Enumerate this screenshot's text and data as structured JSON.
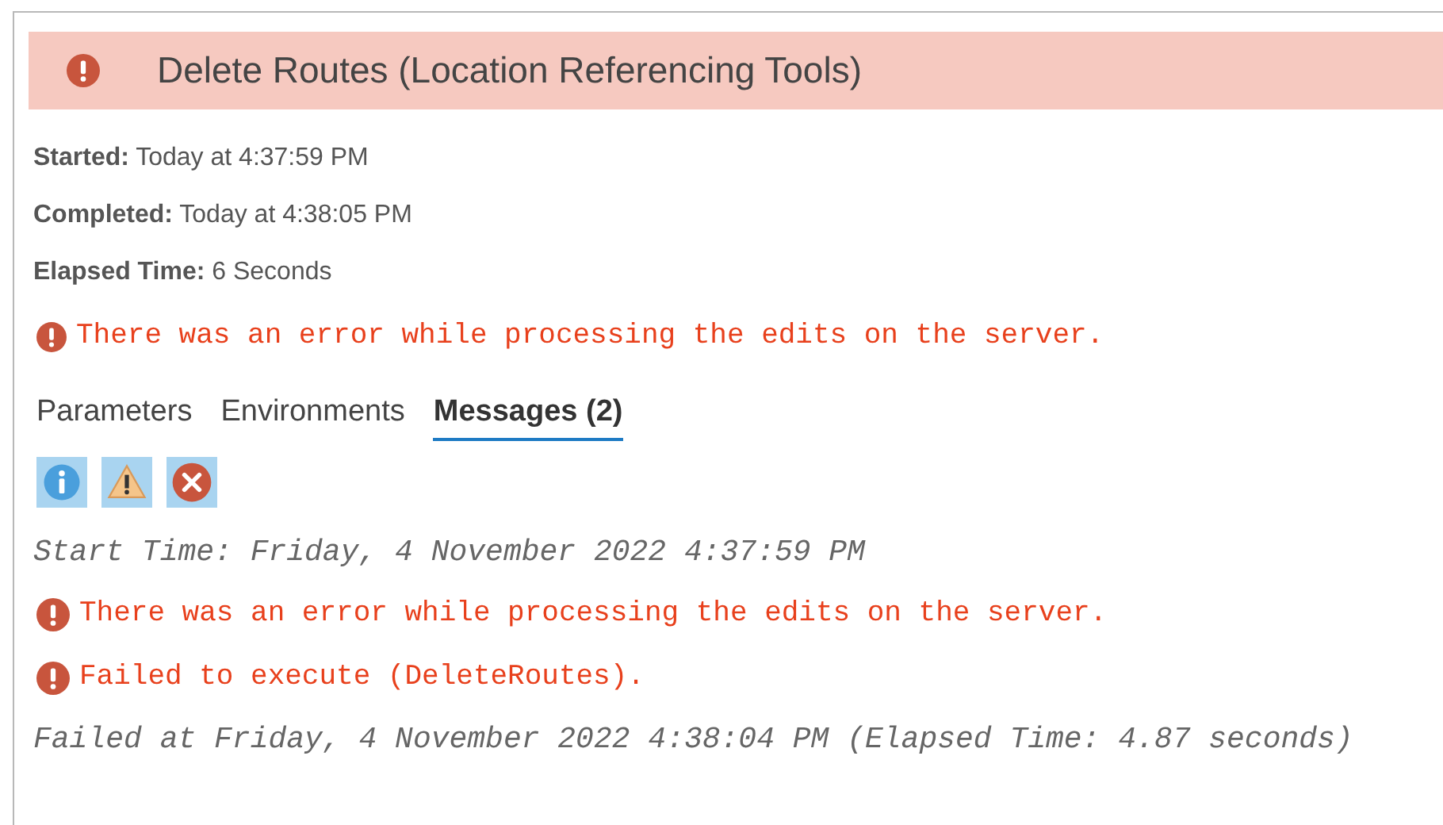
{
  "header": {
    "title": "Delete Routes (Location Referencing Tools)"
  },
  "details": [
    {
      "label": "Started:",
      "value": "Today at 4:37:59 PM"
    },
    {
      "label": "Completed:",
      "value": "Today at 4:38:05 PM"
    },
    {
      "label": "Elapsed Time:",
      "value": "6 Seconds"
    }
  ],
  "summary_error": "There was an error while processing the edits on the server.",
  "tabs": [
    {
      "label": "Parameters",
      "selected": false
    },
    {
      "label": "Environments",
      "selected": false
    },
    {
      "label": "Messages (2)",
      "selected": true
    }
  ],
  "filters": [
    {
      "kind": "info",
      "on": true
    },
    {
      "kind": "warning",
      "on": true
    },
    {
      "kind": "error",
      "on": true
    }
  ],
  "messages": [
    {
      "kind": "info",
      "text": "Start Time: Friday, 4 November 2022 4:37:59 PM"
    },
    {
      "kind": "error",
      "text": "There was an error while processing the edits on the server."
    },
    {
      "kind": "error",
      "text": "Failed to execute (DeleteRoutes)."
    },
    {
      "kind": "info",
      "text": "Failed at Friday, 4 November 2022 4:38:04 PM (Elapsed Time: 4.87 seconds)"
    }
  ]
}
